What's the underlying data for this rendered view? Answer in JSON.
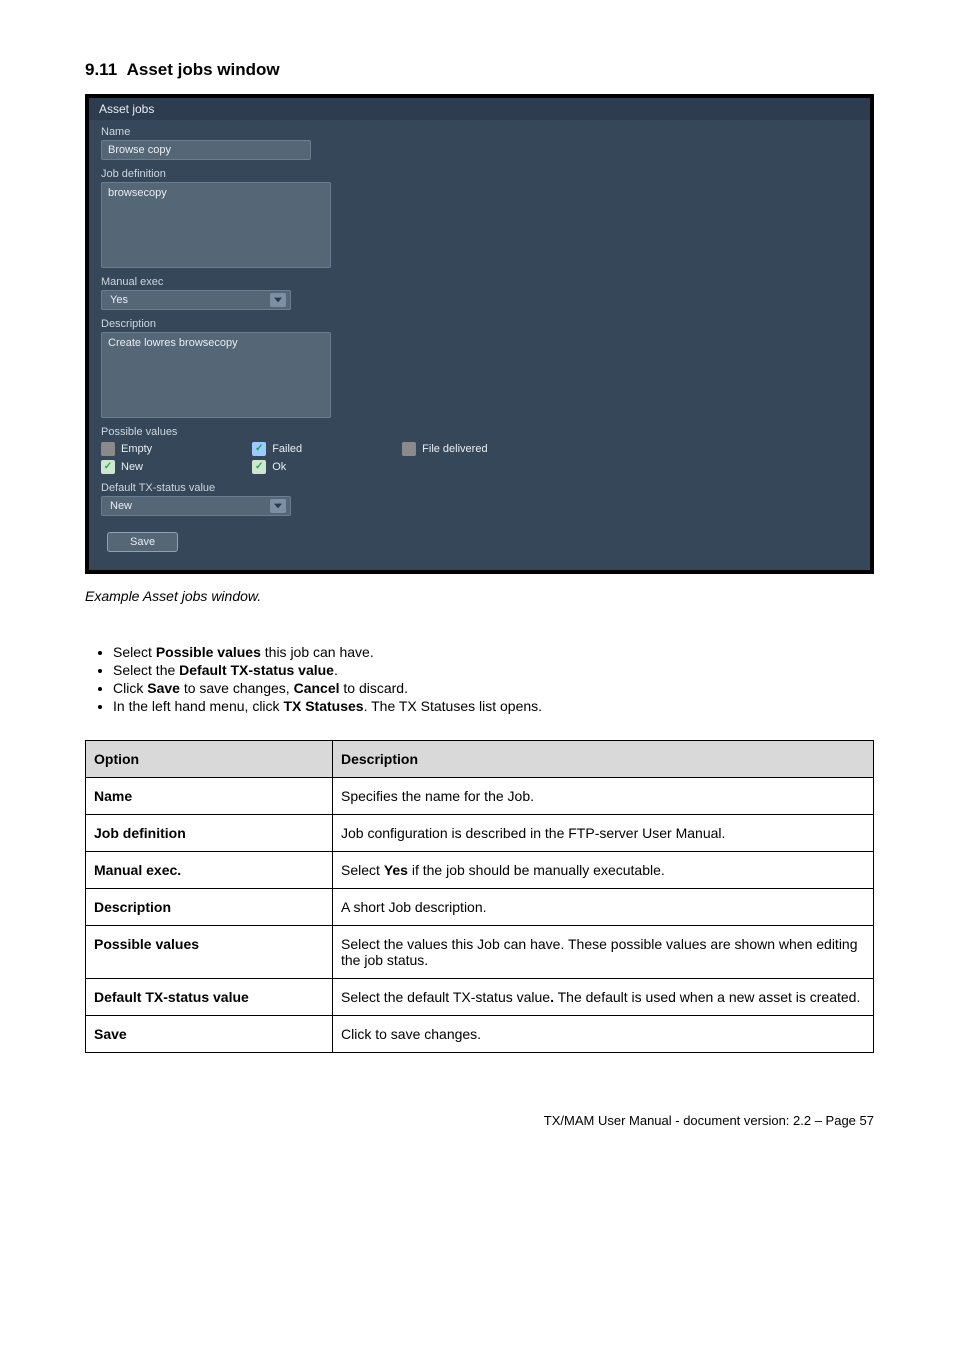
{
  "section": {
    "number": "9.11",
    "title": "Asset jobs window"
  },
  "panel": {
    "title": "Asset jobs",
    "name": {
      "label": "Name",
      "value": "Browse copy"
    },
    "jobdef": {
      "label": "Job definition",
      "value": "browsecopy"
    },
    "manual": {
      "label": "Manual exec",
      "value": "Yes"
    },
    "desc": {
      "label": "Description",
      "value": "Create lowres browsecopy"
    },
    "pv_label": "Possible values",
    "pv": {
      "empty": "Empty",
      "new": "New",
      "failed": "Failed",
      "ok": "Ok",
      "delivered": "File delivered"
    },
    "def_tx": {
      "label": "Default TX-status value",
      "value": "New"
    },
    "save": "Save"
  },
  "caption": "Example Asset jobs window.",
  "instr": [
    {
      "pre": "Select ",
      "b": "Possible values",
      "post": " this job can have."
    },
    {
      "pre": "Select the ",
      "b": "Default TX-status value",
      "post": "."
    }
  ],
  "instr3": {
    "a": "Click ",
    "b": "Save",
    "c": " to save changes, ",
    "d": "Cancel",
    "e": " to discard."
  },
  "instr4": {
    "a": "In the left hand menu, click ",
    "b": "TX Statuses",
    "c": ". The TX Statuses list opens."
  },
  "table": {
    "h1": "Option",
    "h2": "Description",
    "rows": [
      {
        "opt": "Name",
        "desc": "Specifies the name for the Job."
      },
      {
        "opt": "Job definition",
        "desc": "Job configuration is described in the FTP-server User Manual."
      },
      {
        "opt": "Description",
        "desc": "A short Job description."
      },
      {
        "opt": "Possible values",
        "desc": "Select the values this Job can have. These possible values are shown when editing the job status."
      },
      {
        "opt": "Save",
        "desc": "Click to save changes."
      }
    ],
    "manual": {
      "opt": "Manual exec",
      "a": "Select ",
      "b": "Yes",
      "c": " if the job should be manually executable."
    },
    "deftx": {
      "opt": "Default TX-status value",
      "a": "Select the default TX-status value",
      "b": ".",
      "c": " The default is used when a new asset is created."
    }
  },
  "footer": "TX/MAM User Manual - document version: 2.2 – Page 57"
}
